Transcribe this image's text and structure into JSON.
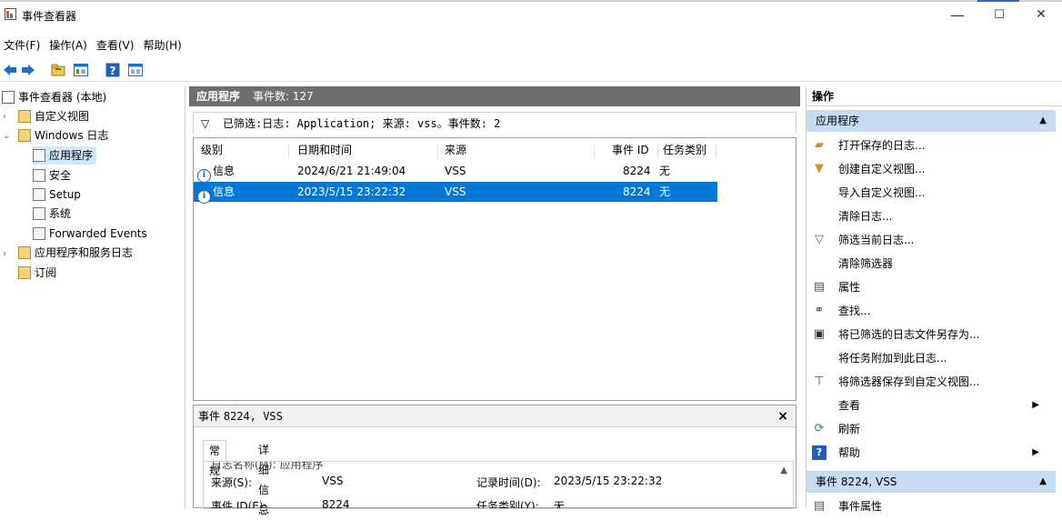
{
  "window": {
    "title": "事件查看器",
    "minimize": "—",
    "maximize": "☐",
    "close": "✕"
  },
  "menu": [
    "文件(F)",
    "操作(A)",
    "查看(V)",
    "帮助(H)"
  ],
  "tree": {
    "root": "事件查看器 (本地)",
    "custom_views": "自定义视图",
    "windows_logs": "Windows 日志",
    "application": "应用程序",
    "security": "安全",
    "setup": "Setup",
    "system": "系统",
    "forwarded": "Forwarded Events",
    "app_service_logs": "应用程序和服务日志",
    "subscriptions": "订阅"
  },
  "center": {
    "header_title": "应用程序",
    "header_count": "事件数: 127",
    "filter_text": "已筛选:日志: Application; 来源: vss。事件数: 2",
    "columns": [
      "级别",
      "日期和时间",
      "来源",
      "事件 ID",
      "任务类别"
    ],
    "rows": [
      {
        "level": "信息",
        "datetime": "2024/6/21 21:49:04",
        "source": "VSS",
        "event_id": "8224",
        "category": "无"
      },
      {
        "level": "信息",
        "datetime": "2023/5/15 23:22:32",
        "source": "VSS",
        "event_id": "8224",
        "category": "无"
      }
    ],
    "detail": {
      "title_prefix": "事件",
      "title_rest": "8224, VSS",
      "tab_general": "常规",
      "tab_details": "详细信息",
      "cut_line": "日志名称(M):  应用程序",
      "source_label": "来源(S):",
      "source_value": "VSS",
      "logged_label": "记录时间(D):",
      "logged_value": "2023/5/15 23:22:32",
      "eventid_label": "事件 ID(E):",
      "eventid_value": "8224",
      "category_label": "任务类别(Y):",
      "category_value": "无"
    }
  },
  "actions": {
    "header": "操作",
    "section1": "应用程序",
    "items": [
      {
        "label": "打开保存的日志...",
        "icon": "folder-open-icon"
      },
      {
        "label": "创建自定义视图...",
        "icon": "filter-icon"
      },
      {
        "label": "导入自定义视图...",
        "icon": ""
      },
      {
        "label": "清除日志...",
        "icon": ""
      },
      {
        "label": "筛选当前日志...",
        "icon": "filter-icon"
      },
      {
        "label": "清除筛选器",
        "icon": ""
      },
      {
        "label": "属性",
        "icon": "properties-icon"
      },
      {
        "label": "查找...",
        "icon": "binoculars-icon"
      },
      {
        "label": "将已筛选的日志文件另存为...",
        "icon": "save-icon"
      },
      {
        "label": "将任务附加到此日志...",
        "icon": ""
      },
      {
        "label": "将筛选器保存到自定义视图...",
        "icon": "filter-save-icon"
      },
      {
        "label": "查看",
        "icon": ""
      },
      {
        "label": "刷新",
        "icon": "refresh-icon"
      },
      {
        "label": "帮助",
        "icon": "help-icon"
      }
    ],
    "section2": "事件 8224, VSS",
    "section2_item": "事件属性"
  }
}
